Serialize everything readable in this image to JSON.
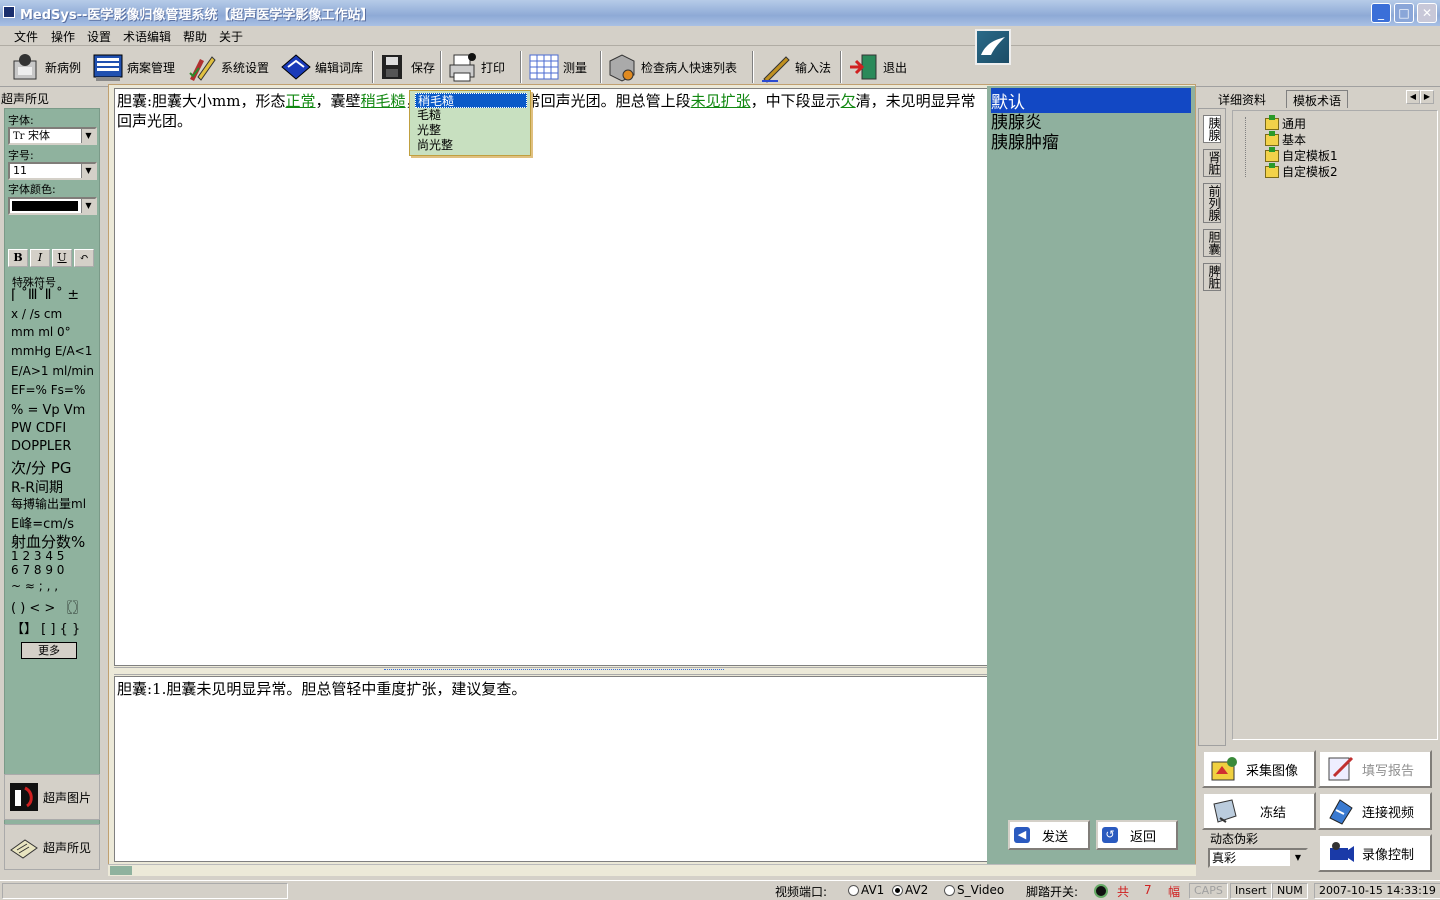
{
  "window": {
    "title": "MedSys--医学影像归像管理系统【超声医学学影像工作站】"
  },
  "menu": [
    "文件",
    "操作",
    "设置",
    "术语编辑",
    "帮助",
    "关于"
  ],
  "toolbar": [
    {
      "label": "新病例",
      "icon": "new-case-icon"
    },
    {
      "label": "病案管理",
      "icon": "records-icon"
    },
    {
      "label": "系统设置",
      "icon": "settings-icon"
    },
    {
      "label": "编辑词库",
      "icon": "dictionary-icon"
    },
    {
      "label": "保存",
      "icon": "save-icon"
    },
    {
      "label": "打印",
      "icon": "print-icon"
    },
    {
      "label": "测量",
      "icon": "measure-icon"
    },
    {
      "label": "检查病人快速列表",
      "icon": "patient-list-icon"
    },
    {
      "label": "输入法",
      "icon": "ime-icon"
    },
    {
      "label": "退出",
      "icon": "exit-icon"
    }
  ],
  "left": {
    "title": "超声所见",
    "font_label": "字体:",
    "font_value": "宋体",
    "font_icon_text": "Tr",
    "size_label": "字号:",
    "size_value": "11",
    "color_label": "字体颜色:",
    "fmt": [
      "B",
      "I",
      "U",
      "↶"
    ],
    "symbols_title": "特殊符号",
    "symbol_rows": [
      "⌈ ˚ⅢˇⅡ ˚ ±",
      "x   /   /s  cm",
      "mm ml   0°",
      "mmHg  E/A<1",
      "E/A>1  ml/min",
      "EF=%   Fs=%",
      "%   =   Vp Vm",
      "PW   CDFI",
      "DOPPLER",
      "次/分   PG",
      "R-R间期",
      "每搏输出量ml",
      "E峰=cm/s",
      "射血分数%",
      "1 2 3 4 5",
      "6 7 8 9 0",
      "~ ≈  ;   ,   ,",
      "( )   < >   〖〗",
      "【】   [ ]    { }"
    ],
    "more_label": "更多",
    "nav": [
      {
        "label": "超声图片"
      },
      {
        "label": "超声所见"
      }
    ]
  },
  "editor": {
    "findings_parts": [
      {
        "t": "胆囊:胆囊大小mm，形态",
        "kw": false
      },
      {
        "t": "正常",
        "kw": true
      },
      {
        "t": "，囊壁",
        "kw": false
      },
      {
        "t": "稍毛糙",
        "kw": true
      },
      {
        "t": "，",
        "kw": false
      },
      {
        "t": "囊内未见明显异常回声光团。胆总管上段",
        "kw": false
      },
      {
        "t": "未见扩张",
        "kw": true
      },
      {
        "t": "，中下段显示",
        "kw": false
      },
      {
        "t": "欠",
        "kw": true
      },
      {
        "t": "清，未见明显异常回声光团。",
        "kw": false
      }
    ],
    "conclusion": "胆囊:1.胆囊未见明显异常。胆总管轻中重度扩张，建议复查。"
  },
  "popup": {
    "options": [
      "稍毛糙",
      "毛糙",
      "光整",
      "尚光整"
    ],
    "selected": 0
  },
  "terms": {
    "items": [
      "默认",
      "胰腺炎",
      "胰腺肿瘤"
    ],
    "selected": 0
  },
  "actions": {
    "send": "发送",
    "back": "返回"
  },
  "right": {
    "tabs": [
      "详细资料",
      "模板术语"
    ],
    "vtabs": [
      "胰腺",
      "肾脏",
      "前列腺",
      "胆囊",
      "脾脏"
    ],
    "tree": [
      "通用",
      "基本",
      "自定模板1",
      "自定模板2"
    ],
    "buttons": {
      "capture": "采集图像",
      "report": "填写报告",
      "freeze": "冻结",
      "video": "连接视频",
      "record": "录像控制"
    },
    "pseudo_label": "动态伪彩",
    "pseudo_value": "真彩"
  },
  "status": {
    "video_port_label": "视频端口:",
    "ports": [
      {
        "label": "AV1",
        "on": false
      },
      {
        "label": "AV2",
        "on": true
      },
      {
        "label": "S_Video",
        "on": false
      }
    ],
    "pedal_label": "脚踏开关:",
    "count_prefix": "共",
    "count": "7",
    "count_unit": "幅",
    "caps": "CAPS",
    "insert": "Insert",
    "num": "NUM",
    "datetime": "2007-10-15 14:33:19"
  }
}
